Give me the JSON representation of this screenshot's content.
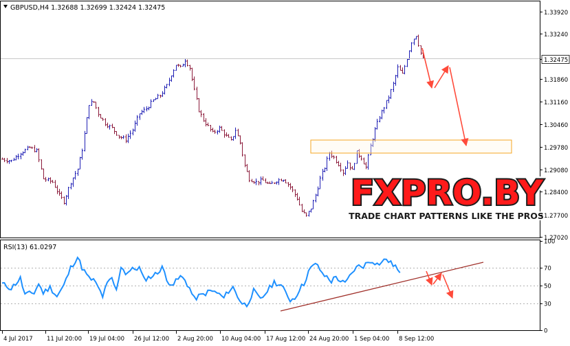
{
  "header": {
    "symbol_line": "GBPUSD,H4  1.32688  1.32699  1.32424  1.32475"
  },
  "price_axis": {
    "ticks": [
      "1.33920",
      "1.33240",
      "1.32475",
      "1.31860",
      "1.31160",
      "1.30460",
      "1.29780",
      "1.29080",
      "1.28400",
      "1.27700",
      "1.27020"
    ],
    "current_price": "1.32475"
  },
  "rsi": {
    "label": "RSI(13) 61.0297",
    "ticks": [
      "100",
      "70",
      "50",
      "30",
      "0"
    ]
  },
  "time_axis": {
    "labels": [
      "4 Jul 2017",
      "11 Jul 20:00",
      "19 Jul 04:00",
      "26 Jul 12:00",
      "2 Aug 20:00",
      "10 Aug 04:00",
      "17 Aug 12:00",
      "24 Aug 20:00",
      "1 Sep 04:00",
      "8 Sep 12:00"
    ]
  },
  "watermark": {
    "logo_text": "FXPRO.BY",
    "tagline": "TRADE CHART PATTERNS LIKE THE PROS"
  },
  "colors": {
    "bull_bar": "#1e1eb4",
    "bear_bar": "#8b1a3a",
    "rsi_line": "#1e90ff",
    "trendline": "#a0302a",
    "arrow": "#ff4a3a",
    "zone": "#f5a623",
    "axis": "#000000",
    "grid": "#cfd6dc"
  },
  "chart_data": {
    "type": "bar",
    "symbol": "GBPUSD",
    "timeframe": "H4",
    "ohlc_last": {
      "open": 1.32688,
      "high": 1.32699,
      "low": 1.32424,
      "close": 1.32475
    },
    "x_start": "4 Jul 2017",
    "x_end": "8 Sep 12:00",
    "ylim": [
      1.2702,
      1.3392
    ],
    "price_path": [
      [
        0,
        1.294
      ],
      [
        4,
        1.2935
      ],
      [
        8,
        1.296
      ],
      [
        12,
        1.2975
      ],
      [
        15,
        1.2965
      ],
      [
        18,
        1.288
      ],
      [
        22,
        1.287
      ],
      [
        25,
        1.283
      ],
      [
        27,
        1.281
      ],
      [
        30,
        1.287
      ],
      [
        33,
        1.291
      ],
      [
        35,
        1.297
      ],
      [
        38,
        1.311
      ],
      [
        40,
        1.3115
      ],
      [
        42,
        1.308
      ],
      [
        45,
        1.305
      ],
      [
        48,
        1.3035
      ],
      [
        51,
        1.301
      ],
      [
        54,
        1.3
      ],
      [
        57,
        1.303
      ],
      [
        60,
        1.308
      ],
      [
        63,
        1.3095
      ],
      [
        66,
        1.312
      ],
      [
        69,
        1.3135
      ],
      [
        72,
        1.3165
      ],
      [
        74,
        1.32
      ],
      [
        76,
        1.323
      ],
      [
        78,
        1.322
      ],
      [
        80,
        1.3245
      ],
      [
        82,
        1.322
      ],
      [
        84,
        1.315
      ],
      [
        86,
        1.309
      ],
      [
        88,
        1.306
      ],
      [
        90,
        1.304
      ],
      [
        92,
        1.302
      ],
      [
        95,
        1.3035
      ],
      [
        98,
        1.301
      ],
      [
        100,
        1.2995
      ],
      [
        102,
        1.303
      ],
      [
        104,
        1.299
      ],
      [
        106,
        1.292
      ],
      [
        108,
        1.288
      ],
      [
        111,
        1.287
      ],
      [
        114,
        1.2875
      ],
      [
        117,
        1.286
      ],
      [
        120,
        1.2875
      ],
      [
        123,
        1.288
      ],
      [
        126,
        1.2855
      ],
      [
        129,
        1.282
      ],
      [
        131,
        1.278
      ],
      [
        133,
        1.2765
      ],
      [
        135,
        1.279
      ],
      [
        137,
        1.283
      ],
      [
        139,
        1.288
      ],
      [
        141,
        1.2915
      ],
      [
        143,
        1.296
      ],
      [
        145,
        1.2945
      ],
      [
        147,
        1.2925
      ],
      [
        149,
        1.29
      ],
      [
        151,
        1.293
      ],
      [
        153,
        1.2905
      ],
      [
        155,
        1.296
      ],
      [
        157,
        1.2945
      ],
      [
        159,
        1.2915
      ],
      [
        161,
        1.298
      ],
      [
        163,
        1.303
      ],
      [
        165,
        1.307
      ],
      [
        167,
        1.31
      ],
      [
        169,
        1.313
      ],
      [
        171,
        1.317
      ],
      [
        173,
        1.322
      ],
      [
        175,
        1.32
      ],
      [
        177,
        1.325
      ],
      [
        179,
        1.33
      ],
      [
        181,
        1.332
      ],
      [
        183,
        1.3265
      ],
      [
        184,
        1.32475
      ]
    ],
    "rsi_indicator": {
      "name": "RSI(13)",
      "last": 61.0297,
      "levels": [
        70,
        50,
        30
      ],
      "ylim": [
        0,
        100
      ],
      "path": [
        [
          0,
          52
        ],
        [
          4,
          47
        ],
        [
          8,
          58
        ],
        [
          10,
          40
        ],
        [
          14,
          42
        ],
        [
          16,
          52
        ],
        [
          18,
          42
        ],
        [
          21,
          48
        ],
        [
          24,
          38
        ],
        [
          27,
          50
        ],
        [
          30,
          70
        ],
        [
          33,
          82
        ],
        [
          35,
          70
        ],
        [
          38,
          58
        ],
        [
          40,
          56
        ],
        [
          42,
          48
        ],
        [
          44,
          38
        ],
        [
          46,
          52
        ],
        [
          48,
          58
        ],
        [
          50,
          44
        ],
        [
          52,
          72
        ],
        [
          54,
          64
        ],
        [
          57,
          68
        ],
        [
          60,
          70
        ],
        [
          62,
          57
        ],
        [
          65,
          60
        ],
        [
          68,
          64
        ],
        [
          70,
          72
        ],
        [
          72,
          55
        ],
        [
          75,
          52
        ],
        [
          78,
          60
        ],
        [
          80,
          56
        ],
        [
          82,
          47
        ],
        [
          84,
          35
        ],
        [
          86,
          38
        ],
        [
          88,
          40
        ],
        [
          91,
          44
        ],
        [
          94,
          42
        ],
        [
          97,
          36
        ],
        [
          99,
          44
        ],
        [
          101,
          48
        ],
        [
          103,
          38
        ],
        [
          105,
          30
        ],
        [
          107,
          28
        ],
        [
          110,
          44
        ],
        [
          113,
          34
        ],
        [
          116,
          44
        ],
        [
          119,
          54
        ],
        [
          122,
          50
        ],
        [
          124,
          42
        ],
        [
          126,
          34
        ],
        [
          128,
          36
        ],
        [
          130,
          46
        ],
        [
          132,
          52
        ],
        [
          134,
          66
        ],
        [
          136,
          72
        ],
        [
          138,
          74
        ],
        [
          140,
          62
        ],
        [
          142,
          60
        ],
        [
          144,
          55
        ],
        [
          146,
          60
        ],
        [
          148,
          55
        ],
        [
          150,
          52
        ],
        [
          152,
          60
        ],
        [
          154,
          68
        ],
        [
          156,
          72
        ],
        [
          158,
          72
        ],
        [
          160,
          76
        ],
        [
          162,
          78
        ],
        [
          164,
          74
        ],
        [
          166,
          76
        ],
        [
          168,
          80
        ],
        [
          170,
          75
        ],
        [
          172,
          72
        ],
        [
          174,
          62
        ]
      ]
    }
  }
}
